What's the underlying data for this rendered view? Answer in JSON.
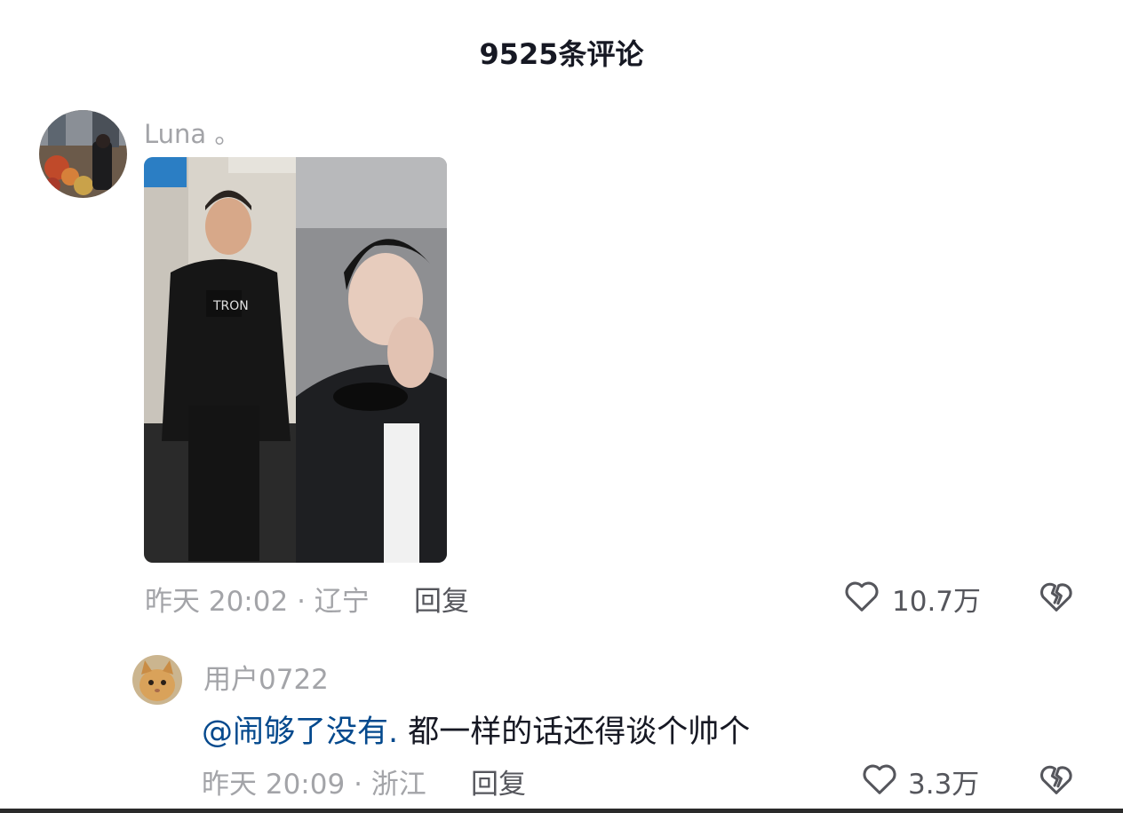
{
  "header": {
    "title": "9525条评论"
  },
  "comment": {
    "username": "Luna 。",
    "image_alt": "photo-comparison",
    "time": "昨天 20:02",
    "separator": "·",
    "location": "辽宁",
    "reply_label": "回复",
    "like_count": "10.7万",
    "icons": {
      "like": "heart-outline-icon",
      "dislike": "broken-heart-icon"
    }
  },
  "reply": {
    "username": "用户0722",
    "mention": "@闹够了没有.",
    "text": " 都一样的话还得谈个帅个",
    "time": "昨天 20:09",
    "separator": "·",
    "location": "浙江",
    "reply_label": "回复",
    "like_count": "3.3万",
    "icons": {
      "like": "heart-outline-icon",
      "dislike": "broken-heart-icon"
    }
  },
  "colors": {
    "mention": "#04498d",
    "meta": "#a3a4a8",
    "text": "#161823"
  }
}
